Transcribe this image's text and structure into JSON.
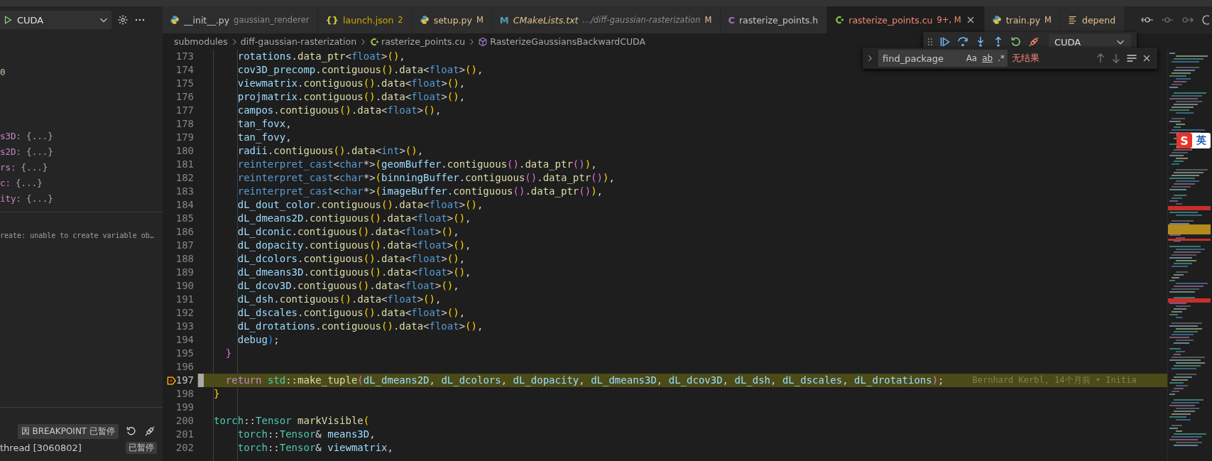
{
  "debug_header": {
    "config": "CUDA"
  },
  "variables": [
    {
      "kind": "value",
      "text": "0"
    },
    {
      "kind": "field",
      "name": "s3D:",
      "value": "{...}"
    },
    {
      "kind": "field",
      "name": "s2D:",
      "value": "{...}"
    },
    {
      "kind": "field",
      "name": "rs:",
      "value": "{...}"
    },
    {
      "kind": "field",
      "name": "c:",
      "value": "{...}"
    },
    {
      "kind": "field",
      "name": "ity:",
      "value": "{...}"
    }
  ],
  "watch": [
    {
      "text": "reate: unable to create variable ob…"
    }
  ],
  "call_stack": {
    "pause_badge": "因 BREAKPOINT 已暂停",
    "threads": [
      {
        "name": "thread [3060802]",
        "status": "已暂停"
      }
    ]
  },
  "tabs": [
    {
      "kind": "python",
      "label": "__init__.py",
      "description": "gaussian_renderer",
      "color": "#c5c5c5",
      "preview": false,
      "selected": false
    },
    {
      "kind": "json",
      "icon_text": "{}",
      "label": "launch.json",
      "badge": "2",
      "color": "#cca700",
      "preview": false,
      "selected": false
    },
    {
      "kind": "python",
      "label": "setup.py",
      "badge": "M",
      "color": "#e2c08d",
      "preview": false,
      "selected": false
    },
    {
      "kind": "cmake",
      "icon_text": "M",
      "label": "CMakeLists.txt",
      "description": "…/diff-gaussian-rasterization",
      "badge": "M",
      "color": "#e2c08d",
      "preview": true,
      "selected": false
    },
    {
      "kind": "c-header",
      "icon_text": "C",
      "label": "rasterize_points.h",
      "color": "#c5c5c5",
      "preview": false,
      "selected": false
    },
    {
      "kind": "cpp",
      "label": "rasterize_points.cu",
      "badge": "9+, M",
      "color": "#f48771",
      "preview": false,
      "selected": true
    },
    {
      "kind": "python",
      "label": "train.py",
      "badge": "M",
      "color": "#e2c08d",
      "preview": false,
      "selected": false
    },
    {
      "kind": "text",
      "label": "depend",
      "color": "#e2c08d",
      "preview": false,
      "selected": false
    }
  ],
  "breadcrumbs": [
    {
      "kind": "folder",
      "label": "submodules"
    },
    {
      "kind": "folder",
      "label": "diff-gaussian-rasterization"
    },
    {
      "kind": "cpp",
      "label": "rasterize_points.cu"
    },
    {
      "kind": "symbol",
      "label": "RasterizeGaussiansBackwardCUDA"
    }
  ],
  "debug_toolbar": {
    "config": "CUDA"
  },
  "find_widget": {
    "value": "find_package",
    "options": [
      "Aa",
      "ab",
      ".*"
    ],
    "result": "无结果"
  },
  "editor": {
    "lines": [
      {
        "number": "173",
        "stopped": false,
        "text": "    rotations.data_ptr<float>(),"
      },
      {
        "number": "174",
        "stopped": false,
        "text": "    cov3D_precomp.contiguous().data<float>(),"
      },
      {
        "number": "175",
        "stopped": false,
        "text": "    viewmatrix.contiguous().data<float>(),"
      },
      {
        "number": "176",
        "stopped": false,
        "text": "    projmatrix.contiguous().data<float>(),"
      },
      {
        "number": "177",
        "stopped": false,
        "text": "    campos.contiguous().data<float>(),"
      },
      {
        "number": "178",
        "stopped": false,
        "text": "    tan_fovx,"
      },
      {
        "number": "179",
        "stopped": false,
        "text": "    tan_fovy,"
      },
      {
        "number": "180",
        "stopped": false,
        "text": "    radii.contiguous().data<int>(),"
      },
      {
        "number": "181",
        "stopped": false,
        "text": "    reinterpret_cast<char*>(geomBuffer.contiguous().data_ptr()),"
      },
      {
        "number": "182",
        "stopped": false,
        "text": "    reinterpret_cast<char*>(binningBuffer.contiguous().data_ptr()),"
      },
      {
        "number": "183",
        "stopped": false,
        "text": "    reinterpret_cast<char*>(imageBuffer.contiguous().data_ptr()),"
      },
      {
        "number": "184",
        "stopped": false,
        "text": "    dL_dout_color.contiguous().data<float>(),"
      },
      {
        "number": "185",
        "stopped": false,
        "text": "    dL_dmeans2D.contiguous().data<float>(),"
      },
      {
        "number": "186",
        "stopped": false,
        "text": "    dL_dconic.contiguous().data<float>(),"
      },
      {
        "number": "187",
        "stopped": false,
        "text": "    dL_dopacity.contiguous().data<float>(),"
      },
      {
        "number": "188",
        "stopped": false,
        "text": "    dL_dcolors.contiguous().data<float>(),"
      },
      {
        "number": "189",
        "stopped": false,
        "text": "    dL_dmeans3D.contiguous().data<float>(),"
      },
      {
        "number": "190",
        "stopped": false,
        "text": "    dL_dcov3D.contiguous().data<float>(),"
      },
      {
        "number": "191",
        "stopped": false,
        "text": "    dL_dsh.contiguous().data<float>(),"
      },
      {
        "number": "192",
        "stopped": false,
        "text": "    dL_dscales.contiguous().data<float>(),"
      },
      {
        "number": "193",
        "stopped": false,
        "text": "    dL_drotations.contiguous().data<float>(),"
      },
      {
        "number": "194",
        "stopped": false,
        "text": "    debug);"
      },
      {
        "number": "195",
        "stopped": false,
        "text": "  }"
      },
      {
        "number": "196",
        "stopped": false
      },
      {
        "number": "197",
        "stopped": true,
        "blame": "Bernhard Kerbl, 14个月前 • Initia",
        "text": "  return std::make_tuple(dL_dmeans2D, dL_dcolors, dL_dopacity, dL_dmeans3D, dL_dcov3D, dL_dsh, dL_dscales, dL_drotations);"
      },
      {
        "number": "198",
        "stopped": false,
        "text": "}"
      },
      {
        "number": "199",
        "stopped": false
      },
      {
        "number": "200",
        "stopped": false,
        "text": "torch::Tensor markVisible("
      },
      {
        "number": "201",
        "stopped": false,
        "text": "    torch::Tensor& means3D,"
      },
      {
        "number": "202",
        "stopped": false,
        "text": "    torch::Tensor& viewmatrix,"
      }
    ]
  },
  "ime_indicator": {
    "logo": "S",
    "label": "英"
  }
}
